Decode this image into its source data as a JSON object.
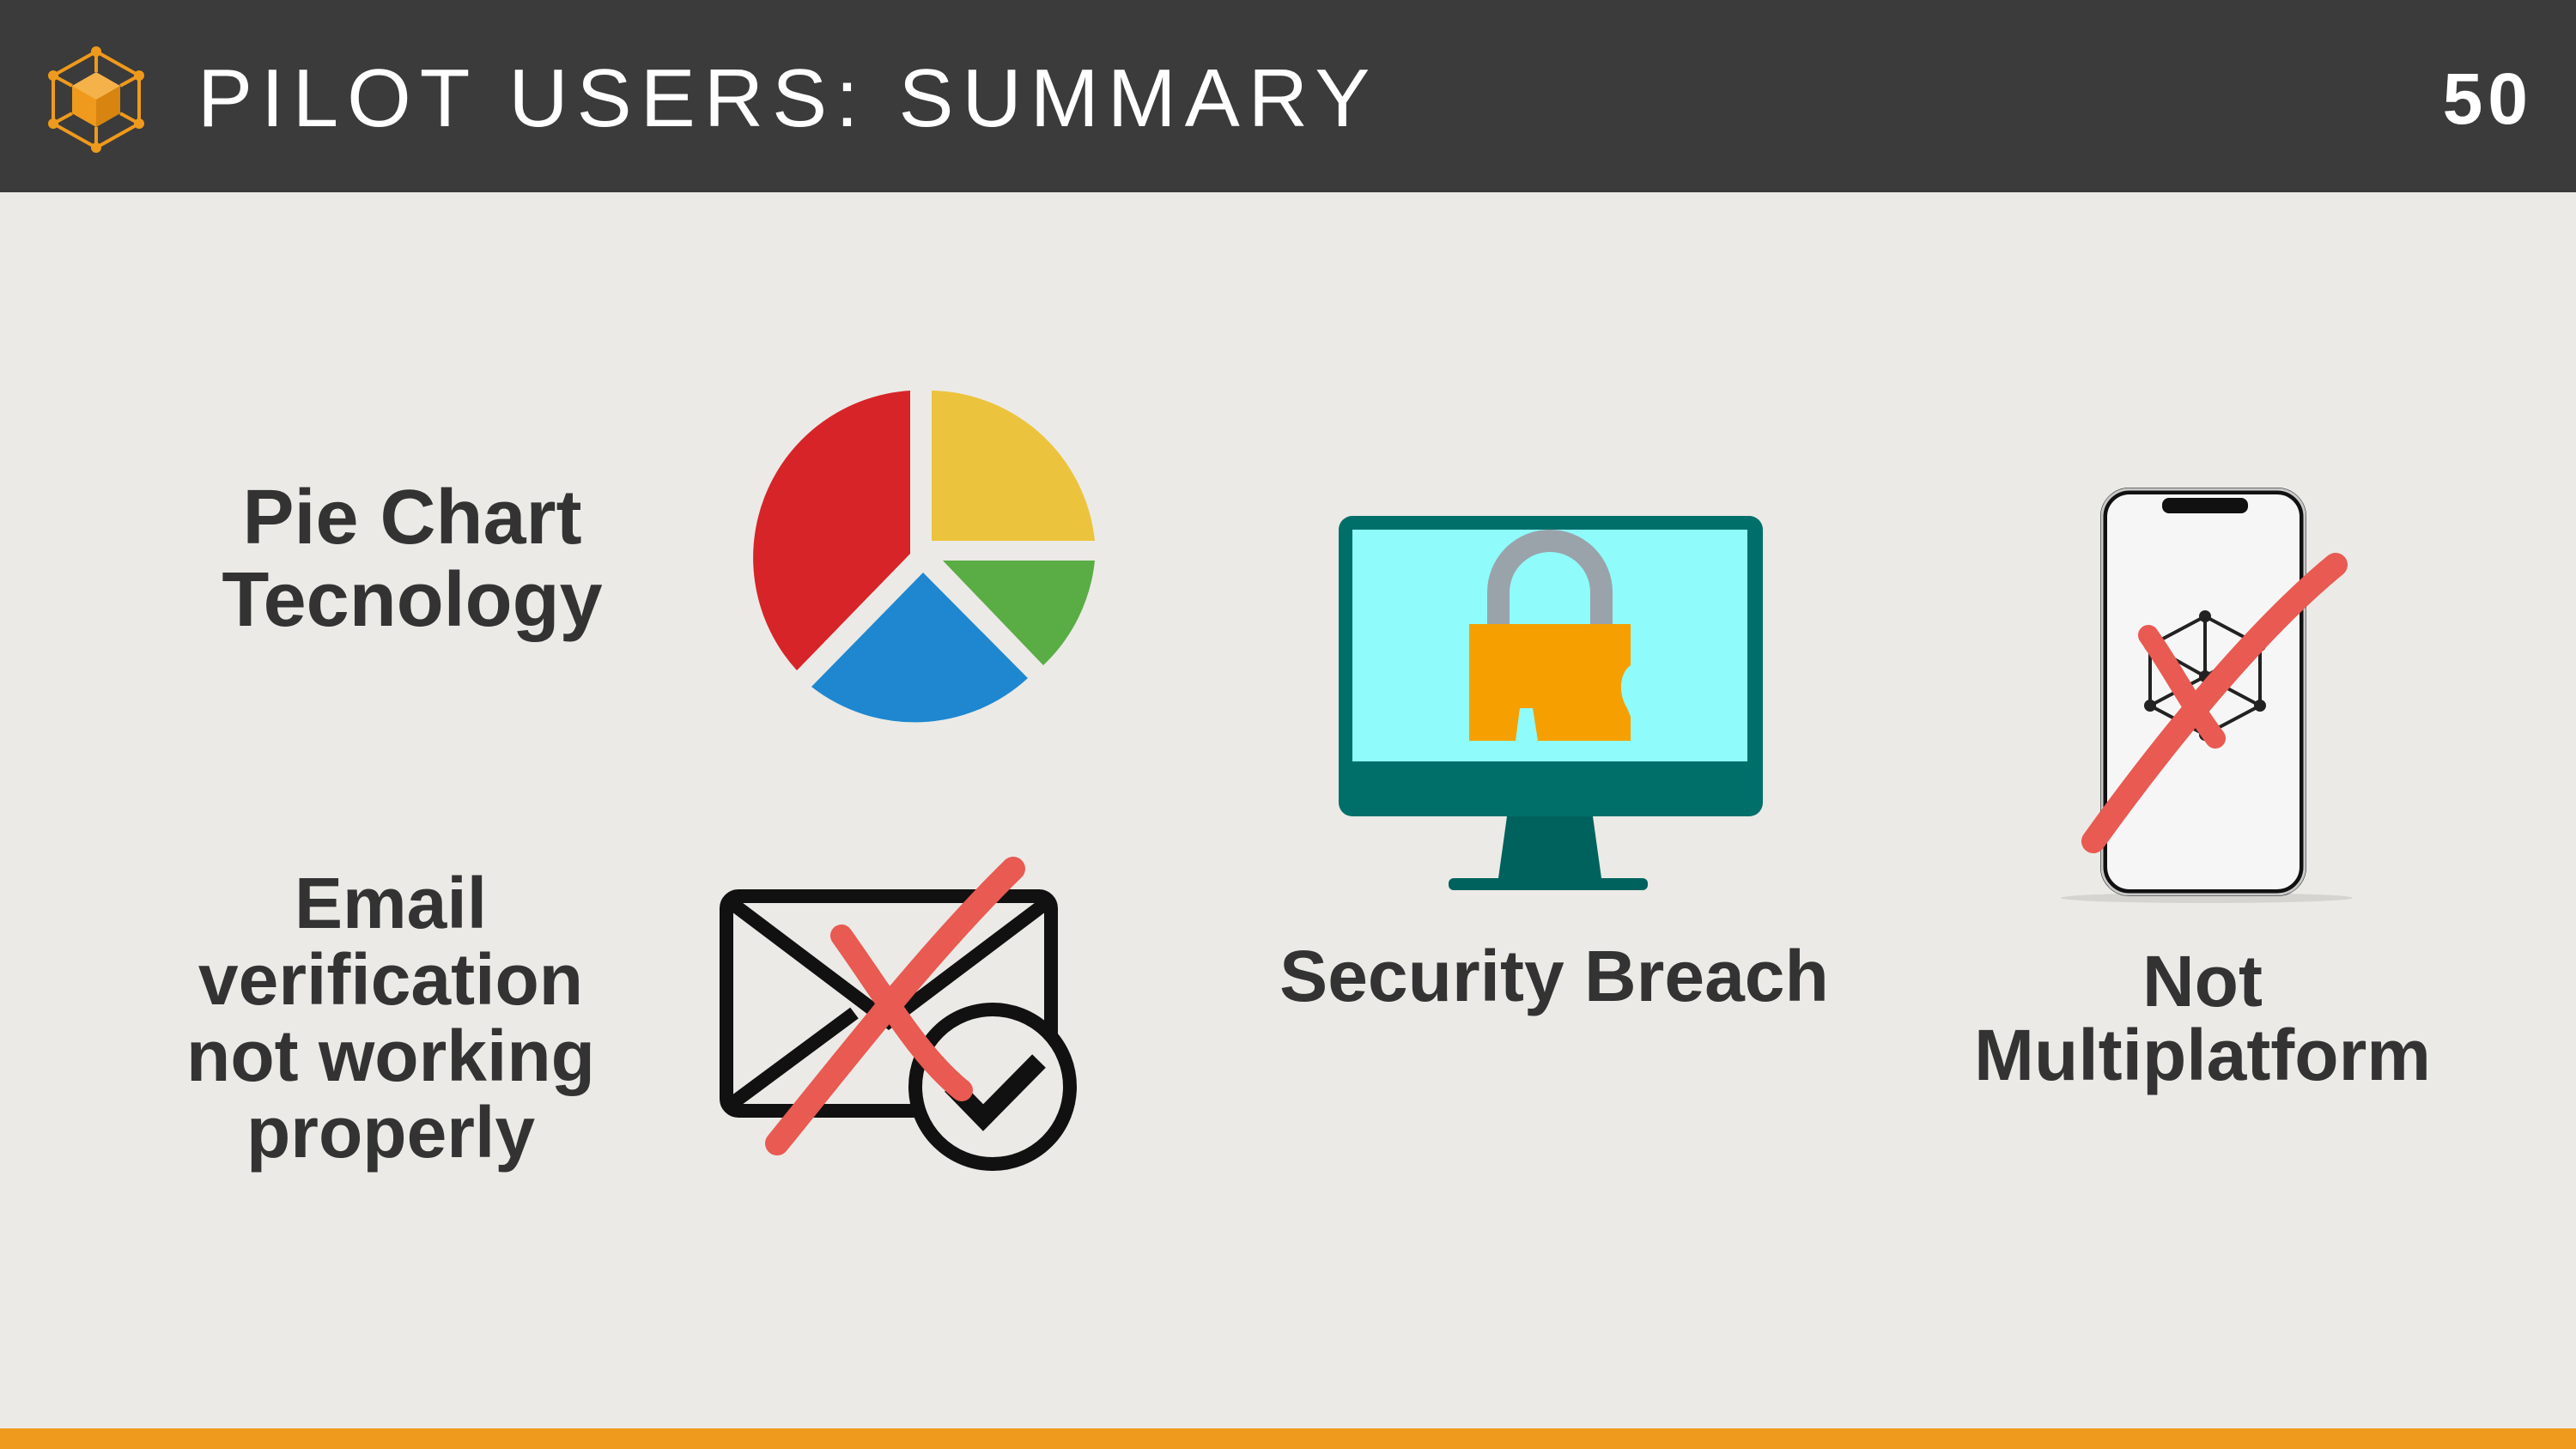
{
  "header": {
    "title": "PILOT USERS: SUMMARY",
    "page_number": "50"
  },
  "items": {
    "pie": {
      "label_lines": [
        "Pie Chart",
        "Tecnology"
      ],
      "icon": "pie-chart-icon"
    },
    "email": {
      "label_lines": [
        "Email",
        "verification",
        "not working",
        "properly"
      ],
      "icon": "email-crossed-icon"
    },
    "security": {
      "label": "Security Breach",
      "icon": "locked-monitor-icon"
    },
    "multiplatform": {
      "label_lines": [
        "Not",
        "Multiplatform"
      ],
      "icon": "phone-crossed-icon"
    }
  },
  "colors": {
    "header_bg": "#3b3b3b",
    "accent": "#ef9a1c",
    "background": "#ebeae6",
    "text": "#333333",
    "cross": "#e85a52"
  }
}
